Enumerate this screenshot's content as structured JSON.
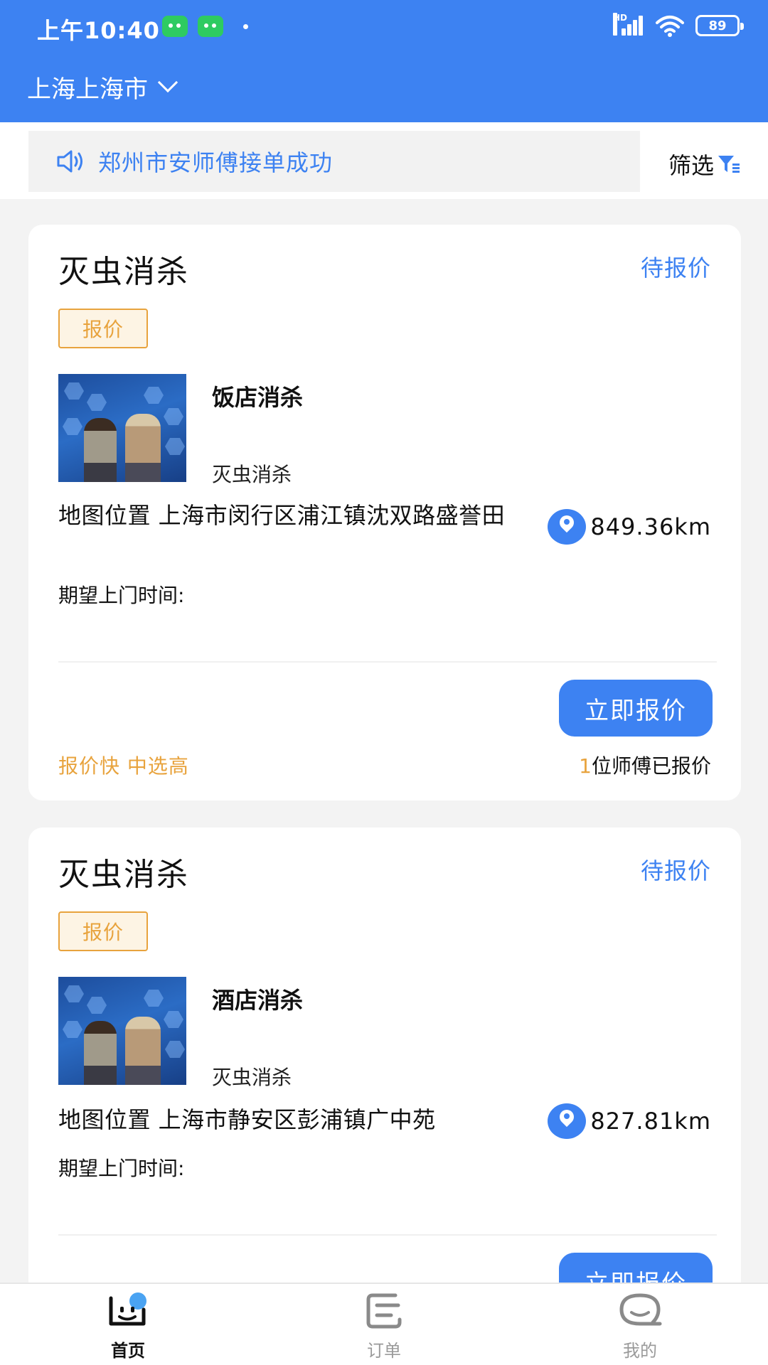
{
  "status_bar": {
    "time": "上午10:40",
    "network_label": "HD",
    "battery": "89",
    "icons": [
      "wechat-icon",
      "wechat-icon",
      "signal-icon",
      "wifi-icon",
      "battery-icon"
    ]
  },
  "header": {
    "city": "上海上海市"
  },
  "notice": {
    "text": "郑州市安师傅接单成功",
    "icon": "speaker-icon"
  },
  "filter": {
    "label": "筛选",
    "icon": "filter-icon"
  },
  "orders": [
    {
      "category": "灭虫消杀",
      "state": "待报价",
      "tag": "报价",
      "service_name": "饭店消杀",
      "service_category": "灭虫消杀",
      "address": "地图位置 上海市闵行区浦江镇沈双路盛誉田",
      "distance": "849.36km",
      "expected_time_label": "期望上门时间:",
      "button": "立即报价",
      "slogan": "报价快 中选高",
      "quote_count": "1",
      "quote_suffix": "位师傅已报价"
    },
    {
      "category": "灭虫消杀",
      "state": "待报价",
      "tag": "报价",
      "service_name": "酒店消杀",
      "service_category": "灭虫消杀",
      "address": "地图位置 上海市静安区彭浦镇广中苑",
      "distance": "827.81km",
      "expected_time_label": "期望上门时间:",
      "button": "立即报价"
    }
  ],
  "tabbar": {
    "items": [
      {
        "label": "首页",
        "icon": "home-smile-icon",
        "active": true
      },
      {
        "label": "订单",
        "icon": "order-icon",
        "active": false
      },
      {
        "label": "我的",
        "icon": "profile-chat-icon",
        "active": false
      }
    ]
  },
  "colors": {
    "primary": "#3d82f2",
    "accent_orange": "#e8a33d",
    "background": "#f3f3f3"
  }
}
